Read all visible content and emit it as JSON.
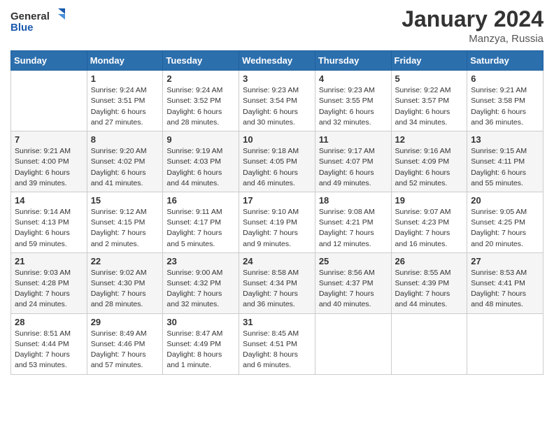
{
  "header": {
    "logo_line1": "General",
    "logo_line2": "Blue",
    "month_year": "January 2024",
    "location": "Manzya, Russia"
  },
  "weekdays": [
    "Sunday",
    "Monday",
    "Tuesday",
    "Wednesday",
    "Thursday",
    "Friday",
    "Saturday"
  ],
  "weeks": [
    [
      {
        "day": "",
        "info": ""
      },
      {
        "day": "1",
        "info": "Sunrise: 9:24 AM\nSunset: 3:51 PM\nDaylight: 6 hours\nand 27 minutes."
      },
      {
        "day": "2",
        "info": "Sunrise: 9:24 AM\nSunset: 3:52 PM\nDaylight: 6 hours\nand 28 minutes."
      },
      {
        "day": "3",
        "info": "Sunrise: 9:23 AM\nSunset: 3:54 PM\nDaylight: 6 hours\nand 30 minutes."
      },
      {
        "day": "4",
        "info": "Sunrise: 9:23 AM\nSunset: 3:55 PM\nDaylight: 6 hours\nand 32 minutes."
      },
      {
        "day": "5",
        "info": "Sunrise: 9:22 AM\nSunset: 3:57 PM\nDaylight: 6 hours\nand 34 minutes."
      },
      {
        "day": "6",
        "info": "Sunrise: 9:21 AM\nSunset: 3:58 PM\nDaylight: 6 hours\nand 36 minutes."
      }
    ],
    [
      {
        "day": "7",
        "info": "Sunrise: 9:21 AM\nSunset: 4:00 PM\nDaylight: 6 hours\nand 39 minutes."
      },
      {
        "day": "8",
        "info": "Sunrise: 9:20 AM\nSunset: 4:02 PM\nDaylight: 6 hours\nand 41 minutes."
      },
      {
        "day": "9",
        "info": "Sunrise: 9:19 AM\nSunset: 4:03 PM\nDaylight: 6 hours\nand 44 minutes."
      },
      {
        "day": "10",
        "info": "Sunrise: 9:18 AM\nSunset: 4:05 PM\nDaylight: 6 hours\nand 46 minutes."
      },
      {
        "day": "11",
        "info": "Sunrise: 9:17 AM\nSunset: 4:07 PM\nDaylight: 6 hours\nand 49 minutes."
      },
      {
        "day": "12",
        "info": "Sunrise: 9:16 AM\nSunset: 4:09 PM\nDaylight: 6 hours\nand 52 minutes."
      },
      {
        "day": "13",
        "info": "Sunrise: 9:15 AM\nSunset: 4:11 PM\nDaylight: 6 hours\nand 55 minutes."
      }
    ],
    [
      {
        "day": "14",
        "info": "Sunrise: 9:14 AM\nSunset: 4:13 PM\nDaylight: 6 hours\nand 59 minutes."
      },
      {
        "day": "15",
        "info": "Sunrise: 9:12 AM\nSunset: 4:15 PM\nDaylight: 7 hours\nand 2 minutes."
      },
      {
        "day": "16",
        "info": "Sunrise: 9:11 AM\nSunset: 4:17 PM\nDaylight: 7 hours\nand 5 minutes."
      },
      {
        "day": "17",
        "info": "Sunrise: 9:10 AM\nSunset: 4:19 PM\nDaylight: 7 hours\nand 9 minutes."
      },
      {
        "day": "18",
        "info": "Sunrise: 9:08 AM\nSunset: 4:21 PM\nDaylight: 7 hours\nand 12 minutes."
      },
      {
        "day": "19",
        "info": "Sunrise: 9:07 AM\nSunset: 4:23 PM\nDaylight: 7 hours\nand 16 minutes."
      },
      {
        "day": "20",
        "info": "Sunrise: 9:05 AM\nSunset: 4:25 PM\nDaylight: 7 hours\nand 20 minutes."
      }
    ],
    [
      {
        "day": "21",
        "info": "Sunrise: 9:03 AM\nSunset: 4:28 PM\nDaylight: 7 hours\nand 24 minutes."
      },
      {
        "day": "22",
        "info": "Sunrise: 9:02 AM\nSunset: 4:30 PM\nDaylight: 7 hours\nand 28 minutes."
      },
      {
        "day": "23",
        "info": "Sunrise: 9:00 AM\nSunset: 4:32 PM\nDaylight: 7 hours\nand 32 minutes."
      },
      {
        "day": "24",
        "info": "Sunrise: 8:58 AM\nSunset: 4:34 PM\nDaylight: 7 hours\nand 36 minutes."
      },
      {
        "day": "25",
        "info": "Sunrise: 8:56 AM\nSunset: 4:37 PM\nDaylight: 7 hours\nand 40 minutes."
      },
      {
        "day": "26",
        "info": "Sunrise: 8:55 AM\nSunset: 4:39 PM\nDaylight: 7 hours\nand 44 minutes."
      },
      {
        "day": "27",
        "info": "Sunrise: 8:53 AM\nSunset: 4:41 PM\nDaylight: 7 hours\nand 48 minutes."
      }
    ],
    [
      {
        "day": "28",
        "info": "Sunrise: 8:51 AM\nSunset: 4:44 PM\nDaylight: 7 hours\nand 53 minutes."
      },
      {
        "day": "29",
        "info": "Sunrise: 8:49 AM\nSunset: 4:46 PM\nDaylight: 7 hours\nand 57 minutes."
      },
      {
        "day": "30",
        "info": "Sunrise: 8:47 AM\nSunset: 4:49 PM\nDaylight: 8 hours\nand 1 minute."
      },
      {
        "day": "31",
        "info": "Sunrise: 8:45 AM\nSunset: 4:51 PM\nDaylight: 8 hours\nand 6 minutes."
      },
      {
        "day": "",
        "info": ""
      },
      {
        "day": "",
        "info": ""
      },
      {
        "day": "",
        "info": ""
      }
    ]
  ]
}
